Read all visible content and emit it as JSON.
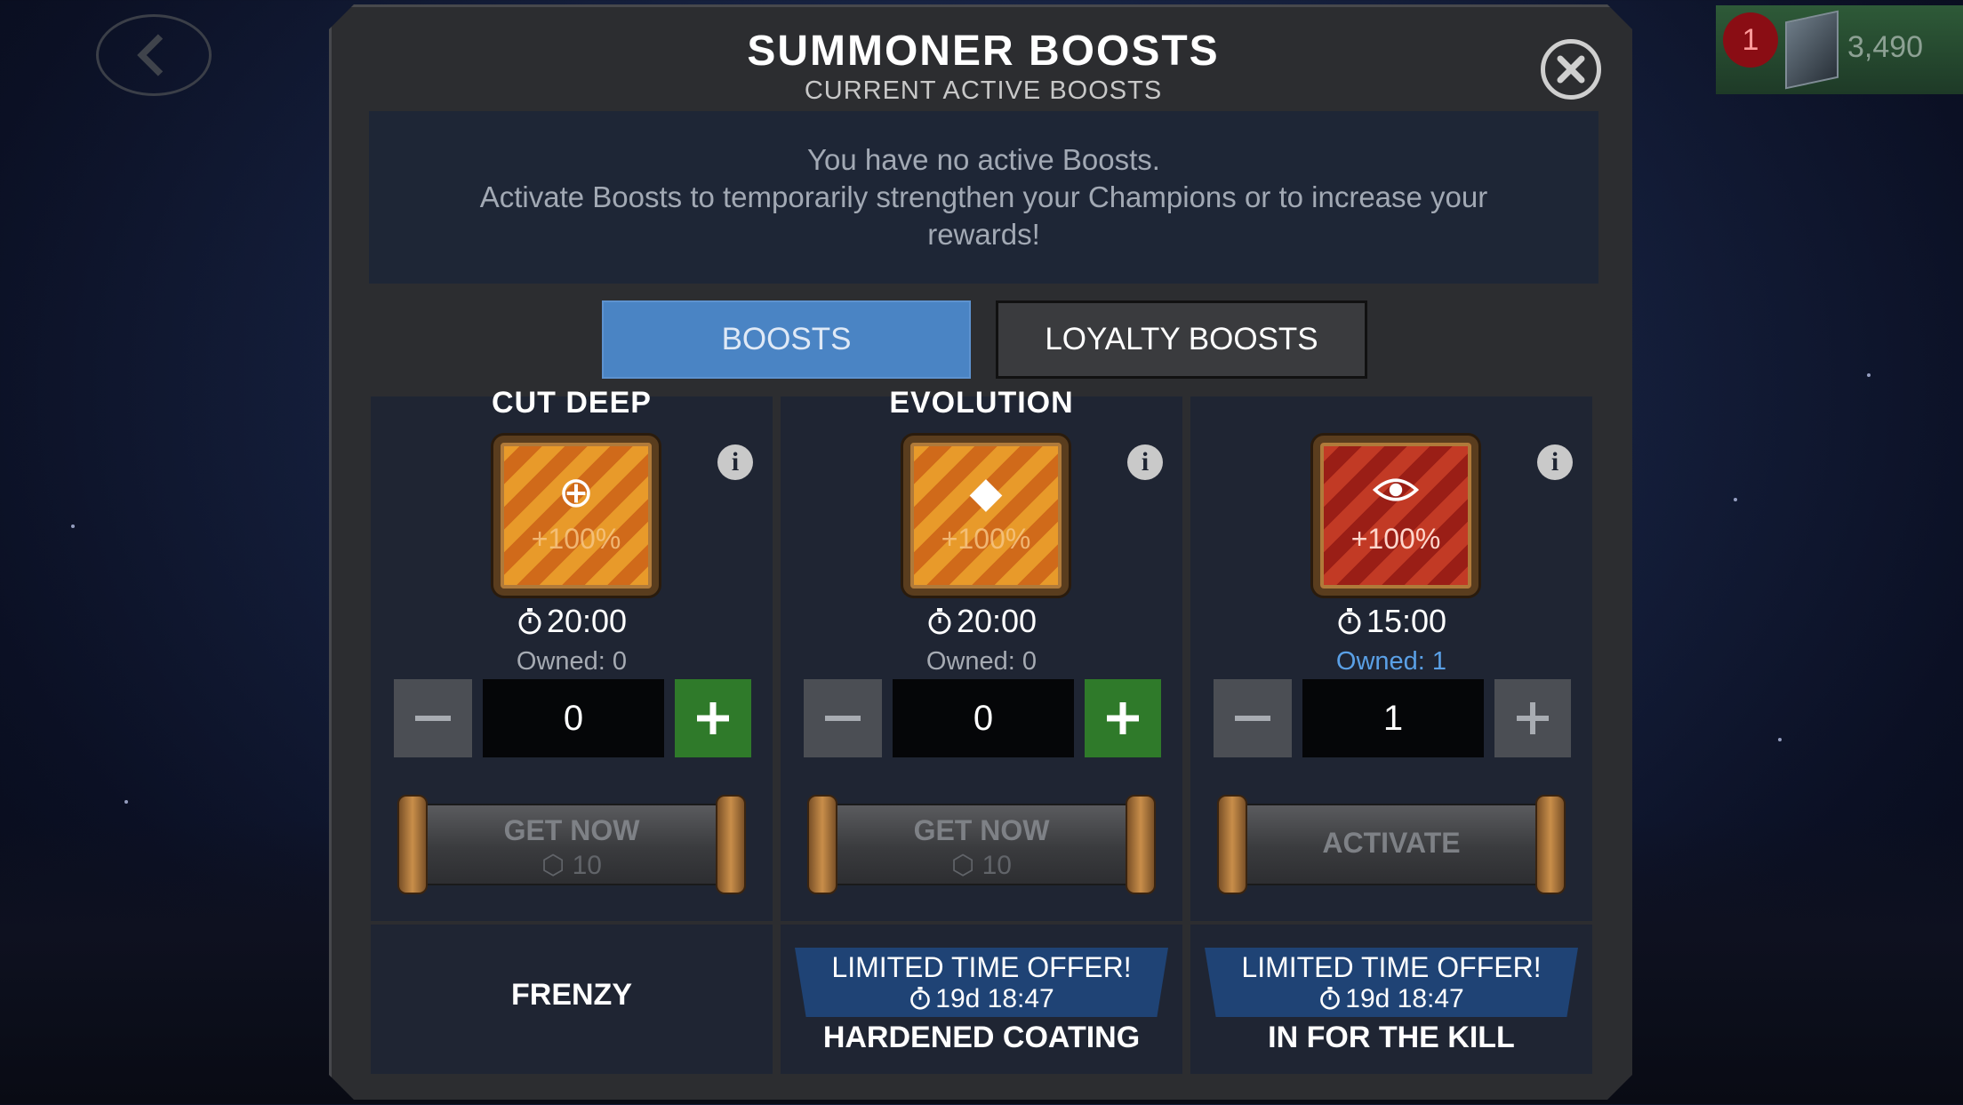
{
  "header": {
    "title": "SUMMONER BOOSTS",
    "subtitle": "CURRENT ACTIVE BOOSTS"
  },
  "topbar": {
    "notification_count": "1",
    "currency_amount": "3,490"
  },
  "active_boosts": {
    "line1": "You have no active Boosts.",
    "line2": "Activate Boosts to temporarily strengthen your Champions or to increase your rewards!"
  },
  "tabs": [
    {
      "label": "BOOSTS",
      "active": true
    },
    {
      "label": "LOYALTY BOOSTS",
      "active": false
    }
  ],
  "boosts": [
    {
      "name": "CUT DEEP",
      "icon": "crosshair-arrow-icon",
      "bonus": "+100%",
      "duration": "20:00",
      "owned": "Owned: 0",
      "quantity": "0",
      "action": "GET NOW",
      "cost": "10"
    },
    {
      "name": "EVOLUTION",
      "icon": "creature-head-icon",
      "bonus": "+100%",
      "duration": "20:00",
      "owned": "Owned: 0",
      "quantity": "0",
      "action": "GET NOW",
      "cost": "10"
    },
    {
      "name": "",
      "icon": "eye-icon",
      "bonus": "+100%",
      "duration": "15:00",
      "owned": "Owned: 1",
      "quantity": "1",
      "action": "ACTIVATE",
      "cost": ""
    }
  ],
  "next_row": [
    {
      "name": "FRENZY"
    },
    {
      "offer": "LIMITED TIME OFFER!",
      "offer_timer": "19d 18:47",
      "name": "HARDENED COATING"
    },
    {
      "offer": "LIMITED TIME OFFER!",
      "offer_timer": "19d 18:47",
      "name": "IN FOR THE KILL"
    }
  ],
  "colors": {
    "tab_active": "#4a84c4",
    "plus_enabled": "#2f7a2a",
    "owned_highlight": "#5aa0e6",
    "offer_banner": "#1f4375"
  }
}
